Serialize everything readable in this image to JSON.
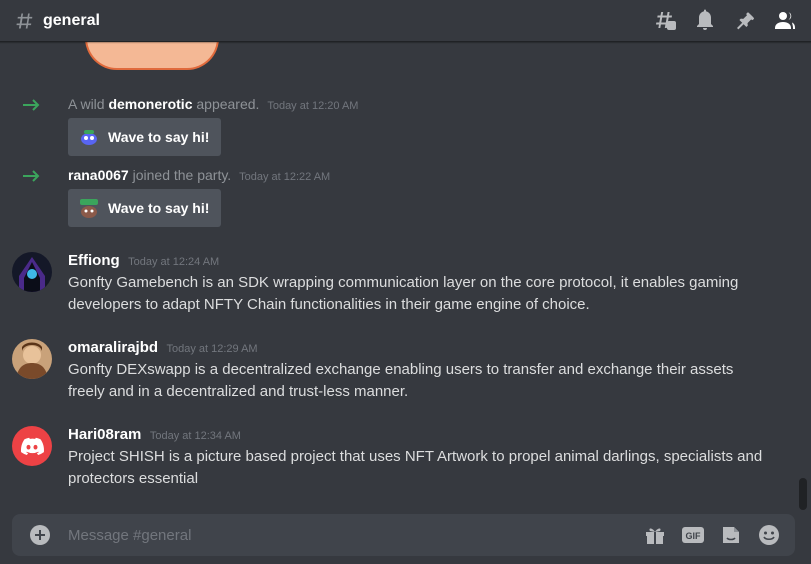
{
  "header": {
    "channel_name": "general",
    "icons": [
      "threads-icon",
      "bell-icon",
      "pin-icon",
      "members-icon"
    ]
  },
  "messages": {
    "system": [
      {
        "prefix": "A wild ",
        "username": "demonerotic",
        "suffix": " appeared.",
        "timestamp": "Today at 12:20 AM",
        "button_label": "Wave to say hi!"
      },
      {
        "prefix": "",
        "username": "rana0067",
        "suffix": " joined the party.",
        "timestamp": "Today at 12:22 AM",
        "button_label": "Wave to say hi!"
      }
    ],
    "chat": [
      {
        "author": "Effiong",
        "timestamp": "Today at 12:24 AM",
        "text": "Gonfty Gamebench is an SDK wrapping communication layer on the core protocol, it enables gaming developers to adapt NFTY Chain functionalities in their game engine of choice."
      },
      {
        "author": "omaralirajbd",
        "timestamp": "Today at 12:29 AM",
        "text": "Gonfty DEXswapp is a decentralized exchange enabling users to transfer and exchange their assets freely and in a decentralized and trust-less manner."
      },
      {
        "author": "Hari08ram",
        "timestamp": "Today at 12:34 AM",
        "text": "Project SHISH is a picture based project that uses NFT Artwork to propel animal darlings, specialists and protectors essential"
      }
    ]
  },
  "composer": {
    "placeholder": "Message #general",
    "gif_label": "GIF"
  },
  "colors": {
    "background": "#36393f",
    "composer": "#40444b",
    "join_arrow": "#3ba55c",
    "discord_red": "#ed4245"
  }
}
